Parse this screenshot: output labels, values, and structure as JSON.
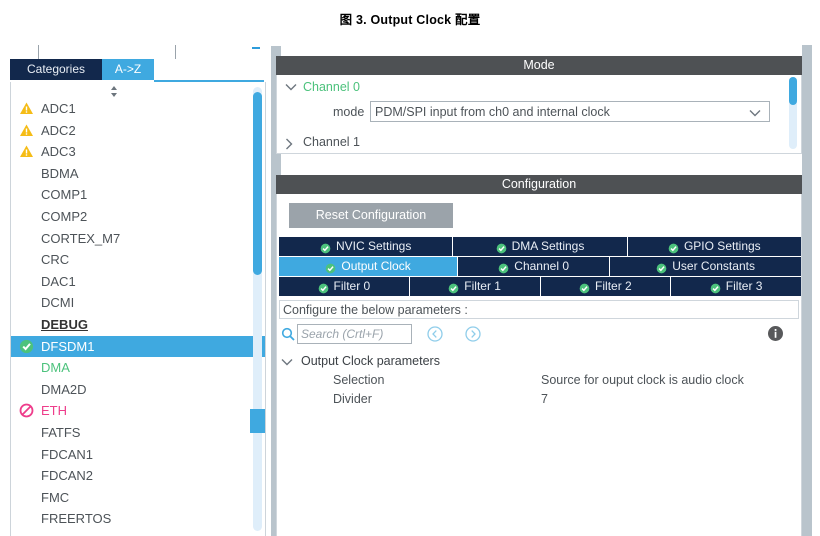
{
  "figure": {
    "caption": "图 3. Output Clock 配置"
  },
  "sidebar": {
    "tabs": [
      {
        "label": "Categories",
        "active": false
      },
      {
        "label": "A->Z",
        "active": true
      }
    ],
    "spinner_icon": "up-down-spinner-icon",
    "items": [
      {
        "label": "ADC1",
        "icon": "warning-icon",
        "state": "warning"
      },
      {
        "label": "ADC2",
        "icon": "warning-icon",
        "state": "warning"
      },
      {
        "label": "ADC3",
        "icon": "warning-icon",
        "state": "warning"
      },
      {
        "label": "BDMA",
        "icon": "none",
        "state": "normal"
      },
      {
        "label": "COMP1",
        "icon": "none",
        "state": "normal"
      },
      {
        "label": "COMP2",
        "icon": "none",
        "state": "normal"
      },
      {
        "label": "CORTEX_M7",
        "icon": "none",
        "state": "normal"
      },
      {
        "label": "CRC",
        "icon": "none",
        "state": "normal"
      },
      {
        "label": "DAC1",
        "icon": "none",
        "state": "normal"
      },
      {
        "label": "DCMI",
        "icon": "none",
        "state": "normal"
      },
      {
        "label": "DEBUG",
        "icon": "none",
        "state": "bold"
      },
      {
        "label": "DFSDM1",
        "icon": "check-icon",
        "state": "selected"
      },
      {
        "label": "DMA",
        "icon": "none",
        "state": "green"
      },
      {
        "label": "DMA2D",
        "icon": "none",
        "state": "normal"
      },
      {
        "label": "ETH",
        "icon": "blocked-icon",
        "state": "pink"
      },
      {
        "label": "FATFS",
        "icon": "none",
        "state": "normal"
      },
      {
        "label": "FDCAN1",
        "icon": "none",
        "state": "normal"
      },
      {
        "label": "FDCAN2",
        "icon": "none",
        "state": "normal"
      },
      {
        "label": "FMC",
        "icon": "none",
        "state": "normal"
      },
      {
        "label": "FREERTOS",
        "icon": "none",
        "state": "normal"
      }
    ]
  },
  "mode": {
    "header": "Mode",
    "channel0": {
      "label": "Channel 0",
      "expanded": true,
      "chevron_icon": "chevron-down-icon",
      "mode_label": "mode",
      "mode_value": "PDM/SPI input from ch0 and internal clock",
      "dropdown_icon": "chevron-down-icon"
    },
    "channel1": {
      "label": "Channel 1",
      "expanded": false,
      "chevron_icon": "chevron-right-icon"
    }
  },
  "configuration": {
    "header": "Configuration",
    "reset_button": "Reset Configuration",
    "tab_rows": [
      [
        {
          "label": "NVIC Settings",
          "active": false,
          "flex": 1
        },
        {
          "label": "DMA Settings",
          "active": false,
          "flex": 1
        },
        {
          "label": "GPIO Settings",
          "active": false,
          "flex": 1
        }
      ],
      [
        {
          "label": "Output Clock",
          "active": true,
          "flex": 1.12
        },
        {
          "label": "Channel 0",
          "active": false,
          "flex": 0.95
        },
        {
          "label": "User Constants",
          "active": false,
          "flex": 1.2
        }
      ],
      [
        {
          "label": "Filter 0",
          "active": false,
          "flex": 1
        },
        {
          "label": "Filter 1",
          "active": false,
          "flex": 1
        },
        {
          "label": "Filter 2",
          "active": false,
          "flex": 1
        },
        {
          "label": "Filter 3",
          "active": false,
          "flex": 1
        }
      ]
    ],
    "note": "Configure the below parameters :",
    "search": {
      "placeholder": "Search (Crtl+F)",
      "value": "",
      "icon": "search-icon",
      "prev_icon": "circle-left-arrow-icon",
      "next_icon": "circle-right-arrow-icon"
    },
    "info_icon": "info-icon",
    "param_group": {
      "title": "Output Clock parameters",
      "chevron_icon": "chevron-down-icon",
      "rows": [
        {
          "name": "Selection",
          "value": "Source for ouput clock is audio clock"
        },
        {
          "name": "Divider",
          "value": "7"
        }
      ]
    }
  },
  "colors": {
    "accent_blue": "#3fa9e0",
    "tab_navy": "#12284c",
    "header_gray": "#4e5154",
    "check_green": "#4cc27c",
    "warning_yellow": "#f5bc16",
    "blocked_pink": "#ee3d8b",
    "scroll_track": "#b9c4cc"
  }
}
